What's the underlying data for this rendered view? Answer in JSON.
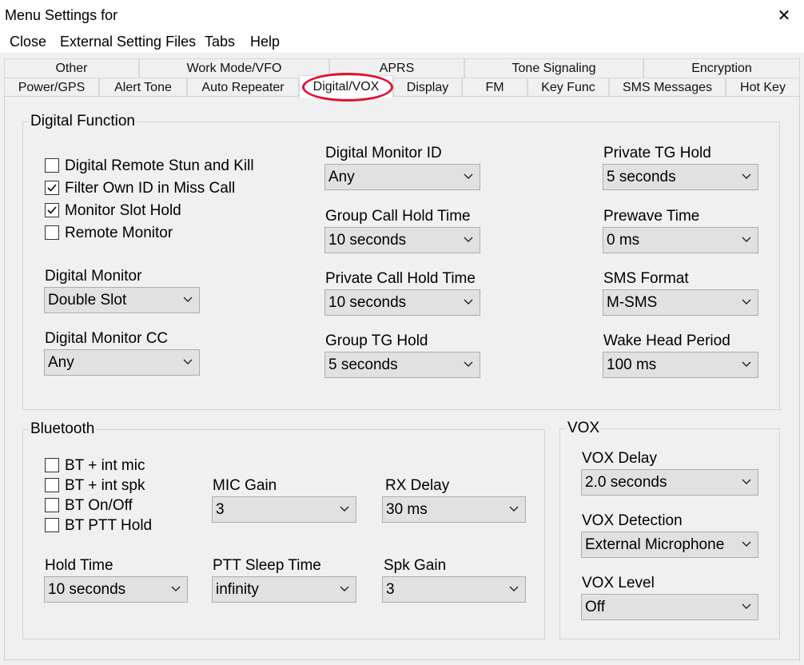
{
  "window": {
    "title": "Menu Settings for",
    "close_glyph": "✕"
  },
  "menu": [
    "Close",
    "External Setting Files",
    "Tabs",
    "Help"
  ],
  "tabs_row1": [
    "Other",
    "Work Mode/VFO",
    "APRS",
    "Tone Signaling",
    "Encryption"
  ],
  "tabs_row2": [
    "Power/GPS",
    "Alert Tone",
    "Auto Repeater",
    "Digital/VOX",
    "Display",
    "FM",
    "Key Func",
    "SMS Messages",
    "Hot Key"
  ],
  "active_tab": "Digital/VOX",
  "annotation_color": "#e01030",
  "digital": {
    "title": "Digital Function",
    "checkboxes": [
      {
        "label": "Digital Remote Stun and Kill",
        "checked": false
      },
      {
        "label": "Filter Own ID in Miss Call",
        "checked": true
      },
      {
        "label": "Monitor Slot Hold",
        "checked": true
      },
      {
        "label": "Remote Monitor",
        "checked": false
      }
    ],
    "digital_monitor": {
      "label": "Digital Monitor",
      "value": "Double Slot"
    },
    "digital_monitor_cc": {
      "label": "Digital Monitor CC",
      "value": "Any"
    },
    "digital_monitor_id": {
      "label": "Digital Monitor ID",
      "value": "Any"
    },
    "group_call_hold_time": {
      "label": "Group Call Hold Time",
      "value": "10 seconds"
    },
    "private_call_hold_time": {
      "label": "Private Call Hold Time",
      "value": "10 seconds"
    },
    "group_tg_hold": {
      "label": "Group TG Hold",
      "value": "5 seconds"
    },
    "private_tg_hold": {
      "label": "Private TG Hold",
      "value": "5 seconds"
    },
    "prewave_time": {
      "label": "Prewave Time",
      "value": "0 ms"
    },
    "sms_format": {
      "label": "SMS Format",
      "value": "M-SMS"
    },
    "wake_head_period": {
      "label": "Wake Head Period",
      "value": "100 ms"
    }
  },
  "bluetooth": {
    "title": "Bluetooth",
    "checkboxes": [
      {
        "label": "BT + int mic",
        "checked": false
      },
      {
        "label": "BT + int spk",
        "checked": false
      },
      {
        "label": "BT On/Off",
        "checked": false
      },
      {
        "label": "BT PTT Hold",
        "checked": false
      }
    ],
    "mic_gain": {
      "label": "MIC Gain",
      "value": "3"
    },
    "rx_delay": {
      "label": "RX Delay",
      "value": "30 ms"
    },
    "hold_time": {
      "label": "Hold Time",
      "value": "10 seconds"
    },
    "ptt_sleep_time": {
      "label": "PTT Sleep Time",
      "value": "infinity"
    },
    "spk_gain": {
      "label": "Spk Gain",
      "value": "3"
    }
  },
  "vox": {
    "title": "VOX",
    "vox_delay": {
      "label": "VOX Delay",
      "value": "2.0 seconds"
    },
    "vox_detection": {
      "label": "VOX Detection",
      "value": "External Microphone"
    },
    "vox_level": {
      "label": "VOX Level",
      "value": "Off"
    }
  }
}
